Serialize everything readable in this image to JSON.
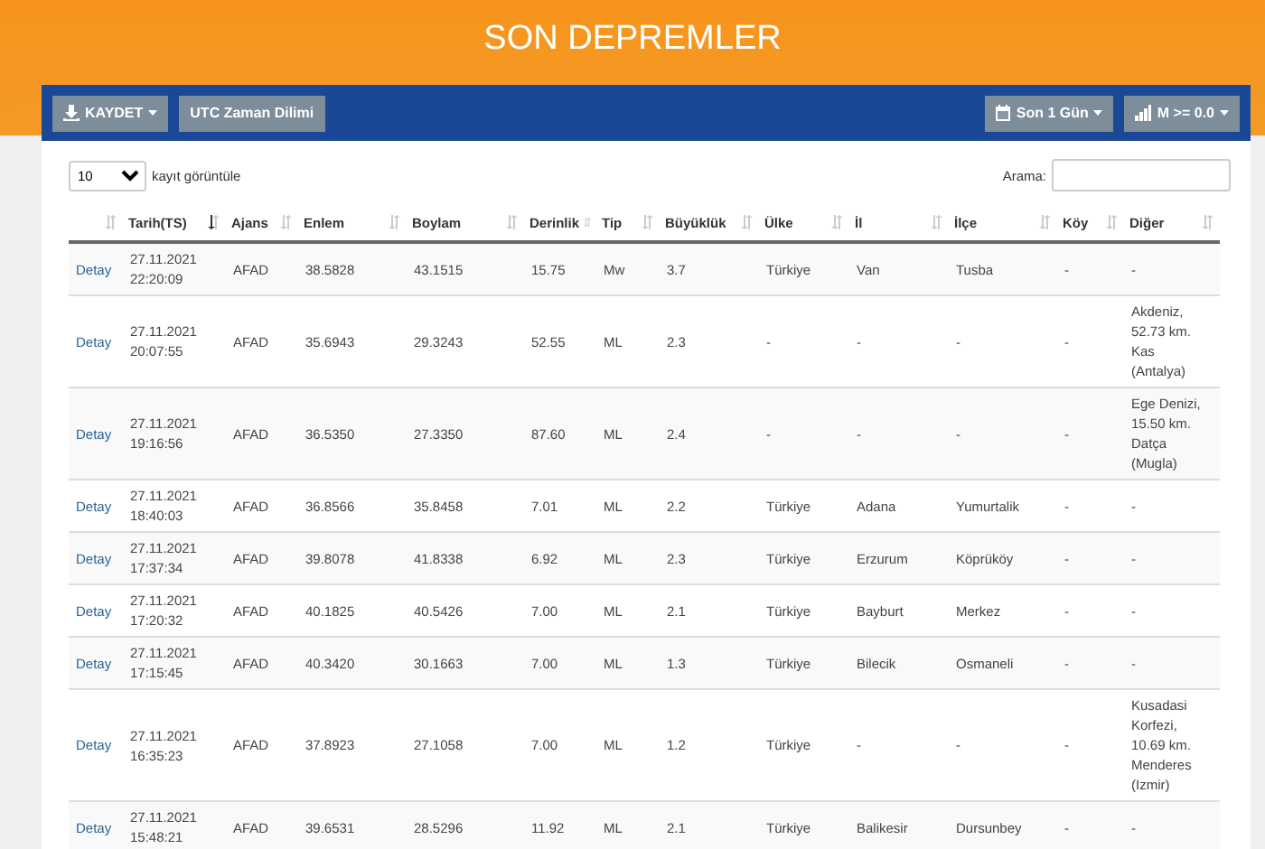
{
  "page_title": "SON DEPREMLER",
  "toolbar": {
    "left": [
      {
        "label": "KAYDET",
        "dropdown": true
      },
      {
        "label": "UTC Zaman Dilimi",
        "dropdown": false
      }
    ],
    "right": [
      {
        "label": "Son 1 Gün",
        "dropdown": true
      },
      {
        "label": "M >= 0.0",
        "dropdown": true
      }
    ]
  },
  "page_length": {
    "value": "10",
    "label": "kayıt görüntüle"
  },
  "search": {
    "label": "Arama:"
  },
  "table": {
    "columns": [
      {
        "sorted": false
      },
      {
        "label": "Tarih(TS)",
        "sorted": true
      },
      {
        "label": "Ajans",
        "sorted": false
      },
      {
        "label": "Enlem",
        "sorted": false
      },
      {
        "label": "Boylam",
        "sorted": false
      },
      {
        "label": "Derinlik",
        "sorted": false
      },
      {
        "label": "Tip",
        "sorted": false
      },
      {
        "label": "Büyüklük",
        "sorted": false
      },
      {
        "label": "Ülke",
        "sorted": false
      },
      {
        "label": "İl",
        "sorted": false
      },
      {
        "label": "İlçe",
        "sorted": false
      },
      {
        "label": "Köy",
        "sorted": false
      },
      {
        "label": "Diğer",
        "sorted": false
      }
    ],
    "rows": [
      [
        "Detay",
        "27.11.2021 22:20:09",
        "AFAD",
        "38.5828",
        "43.1515",
        "15.75",
        "Mw",
        "3.7",
        "Türkiye",
        "Van",
        "Tusba",
        "-",
        "-"
      ],
      [
        "Detay",
        "27.11.2021 20:07:55",
        "AFAD",
        "35.6943",
        "29.3243",
        "52.55",
        "ML",
        "2.3",
        "-",
        "-",
        "-",
        "-",
        "Akdeniz, 52.73 km. Kas (Antalya)"
      ],
      [
        "Detay",
        "27.11.2021 19:16:56",
        "AFAD",
        "36.5350",
        "27.3350",
        "87.60",
        "ML",
        "2.4",
        "-",
        "-",
        "-",
        "-",
        "Ege Denizi, 15.50 km. Datça (Mugla)"
      ],
      [
        "Detay",
        "27.11.2021 18:40:03",
        "AFAD",
        "36.8566",
        "35.8458",
        "7.01",
        "ML",
        "2.2",
        "Türkiye",
        "Adana",
        "Yumurtalik",
        "-",
        "-"
      ],
      [
        "Detay",
        "27.11.2021 17:37:34",
        "AFAD",
        "39.8078",
        "41.8338",
        "6.92",
        "ML",
        "2.3",
        "Türkiye",
        "Erzurum",
        "Köprüköy",
        "-",
        "-"
      ],
      [
        "Detay",
        "27.11.2021 17:20:32",
        "AFAD",
        "40.1825",
        "40.5426",
        "7.00",
        "ML",
        "2.1",
        "Türkiye",
        "Bayburt",
        "Merkez",
        "-",
        "-"
      ],
      [
        "Detay",
        "27.11.2021 17:15:45",
        "AFAD",
        "40.3420",
        "30.1663",
        "7.00",
        "ML",
        "1.3",
        "Türkiye",
        "Bilecik",
        "Osmaneli",
        "-",
        "-"
      ],
      [
        "Detay",
        "27.11.2021 16:35:23",
        "AFAD",
        "37.8923",
        "27.1058",
        "7.00",
        "ML",
        "1.2",
        "Türkiye",
        "-",
        "-",
        "-",
        "Kusadasi Korfezi, 10.69 km. Menderes (Izmir)"
      ],
      [
        "Detay",
        "27.11.2021 15:48:21",
        "AFAD",
        "39.6531",
        "28.5296",
        "11.92",
        "ML",
        "2.1",
        "Türkiye",
        "Balikesir",
        "Dursunbey",
        "-",
        "-"
      ]
    ]
  }
}
